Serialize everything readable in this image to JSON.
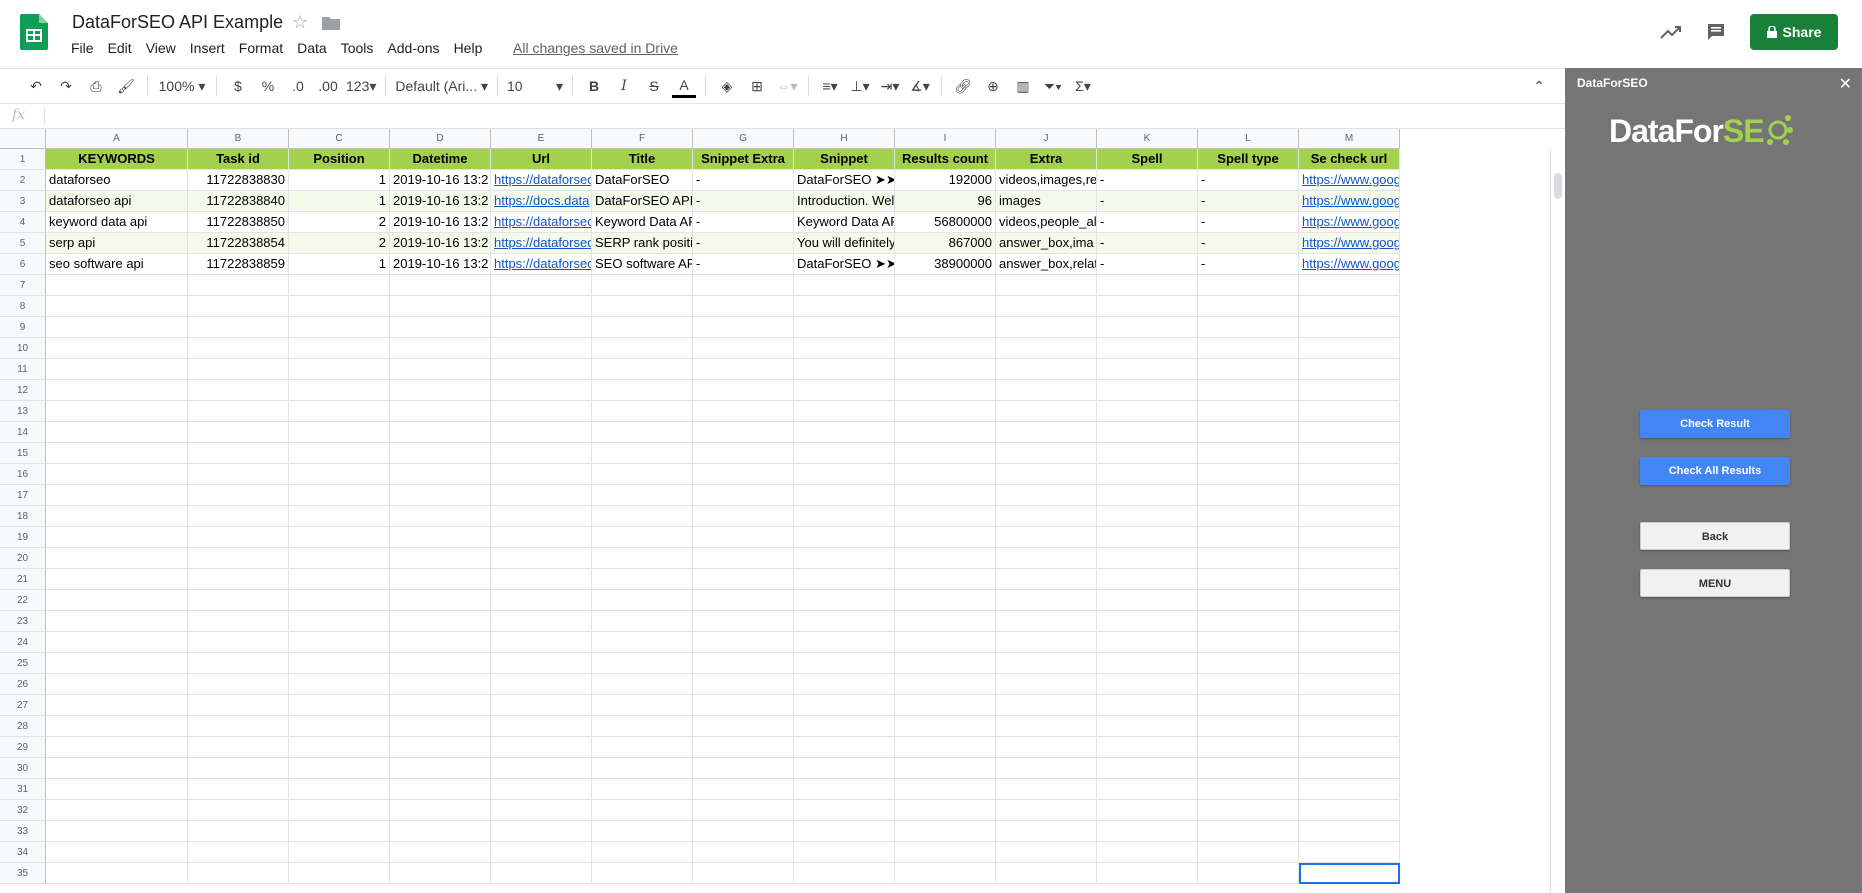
{
  "doc": {
    "title": "DataForSEO API Example",
    "saved_status": "All changes saved in Drive",
    "menus": [
      "File",
      "Edit",
      "View",
      "Insert",
      "Format",
      "Data",
      "Tools",
      "Add-ons",
      "Help"
    ],
    "share_label": "Share"
  },
  "toolbar": {
    "zoom": "100%",
    "currency": "$",
    "percent": "%",
    "dec_less": ".0",
    "dec_more": ".00",
    "format_more": "123",
    "font": "Default (Ari...",
    "font_size": "10"
  },
  "formula_bar": {
    "fx": "fx",
    "value": ""
  },
  "grid": {
    "columns": [
      "A",
      "B",
      "C",
      "D",
      "E",
      "F",
      "G",
      "H",
      "I",
      "J",
      "K",
      "L",
      "M"
    ],
    "headers": [
      "KEYWORDS",
      "Task id",
      "Position",
      "Datetime",
      "Url",
      "Title",
      "Snippet Extra",
      "Snippet",
      "Results count",
      "Extra",
      "Spell",
      "Spell type",
      "Se check url"
    ],
    "rows": [
      [
        "dataforseo",
        "11722838830",
        "1",
        "2019-10-16 13:2",
        "https://dataforseo",
        "DataForSEO",
        "-",
        "DataForSEO ➤➤",
        "192000",
        "videos,images,re",
        "-",
        "-",
        "https://www.goog"
      ],
      [
        "dataforseo api",
        "11722838840",
        "1",
        "2019-10-16 13:2",
        "https://docs.data",
        "DataForSEO API",
        "-",
        "Introduction. Wel",
        "96",
        "images",
        "-",
        "-",
        "https://www.goog"
      ],
      [
        "keyword data api",
        "11722838850",
        "2",
        "2019-10-16 13:2",
        "https://dataforseo",
        "Keyword Data AP",
        "-",
        "Keyword Data AP",
        "56800000",
        "videos,people_al",
        "-",
        "-",
        "https://www.goog"
      ],
      [
        "serp api",
        "11722838854",
        "2",
        "2019-10-16 13:2",
        "https://dataforseo",
        "SERP rank positi",
        "-",
        "You will definitely",
        "867000",
        "answer_box,ima",
        "-",
        "-",
        "https://www.goog"
      ],
      [
        "seo software api",
        "11722838859",
        "1",
        "2019-10-16 13:2",
        "https://dataforseo",
        "SEO software AP",
        "-",
        "DataForSEO ➤➤",
        "38900000",
        "answer_box,relat",
        "-",
        "-",
        "https://www.goog"
      ]
    ],
    "row_count": 35
  },
  "sidebar": {
    "title": "DataForSEO",
    "close": "✕",
    "logo_text_a": "DataFor",
    "logo_text_b": "SE",
    "buttons": {
      "check_result": "Check Result",
      "check_all": "Check All Results",
      "back": "Back",
      "menu": "MENU"
    }
  },
  "colors": {
    "header_green": "#a3d04f",
    "share_green": "#188038",
    "button_blue": "#4285f4",
    "panel_gray": "#757575"
  }
}
